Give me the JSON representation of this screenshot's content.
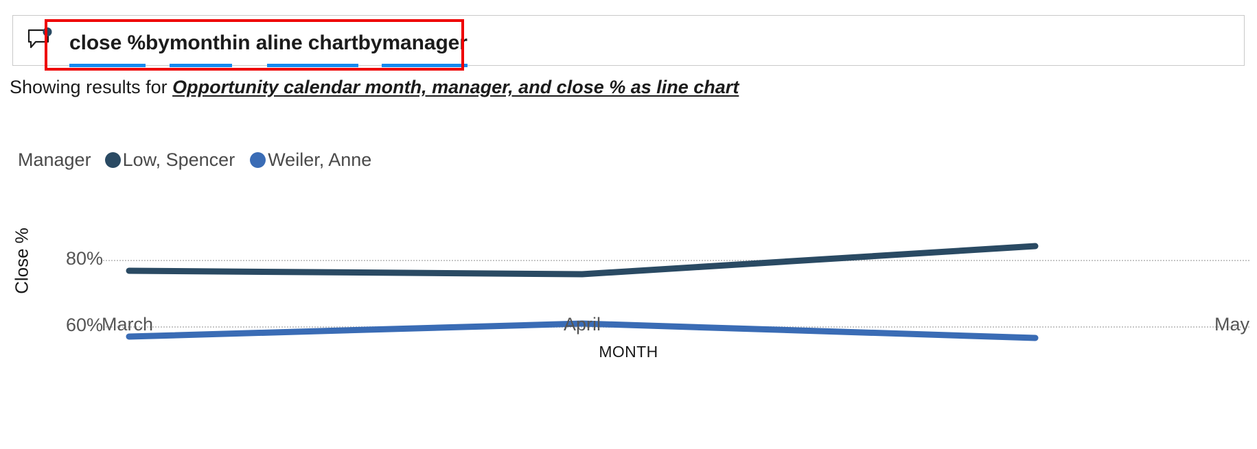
{
  "query_bar": {
    "icon": "chat-bubble-icon",
    "tokens": [
      {
        "text": "close %",
        "highlighted": true
      },
      {
        "text": " by ",
        "highlighted": false
      },
      {
        "text": "month",
        "highlighted": true
      },
      {
        "text": " in a ",
        "highlighted": false
      },
      {
        "text": "line chart",
        "highlighted": true
      },
      {
        "text": " by ",
        "highlighted": false
      },
      {
        "text": "manager",
        "highlighted": true
      }
    ],
    "full_text": "close % by month in a line chart by manager",
    "underline_color": "#1589ee",
    "annotation_color": "#ee0000"
  },
  "showing_results": {
    "prefix": "Showing results for ",
    "link": "Opportunity calendar month, manager, and close % as line chart"
  },
  "chart_data": {
    "type": "line",
    "title": "",
    "xlabel": "MONTH",
    "ylabel": "Close %",
    "categories": [
      "March",
      "April",
      "May"
    ],
    "x_tick_labels": [
      "March",
      "April",
      "May"
    ],
    "y_tick_labels": [
      "80%",
      "60%"
    ],
    "y_ticks": [
      80,
      60
    ],
    "ylim": [
      52,
      88
    ],
    "grid": true,
    "grid_style": "dotted",
    "legend_title": "Manager",
    "legend_position": "top-left",
    "series": [
      {
        "name": "Low, Spencer",
        "color": "#2a4a63",
        "values": [
          76.5,
          76.0,
          82.0
        ]
      },
      {
        "name": "Weiler, Anne",
        "color": "#3a6cb5",
        "values": [
          57.5,
          60.8,
          57.3
        ]
      }
    ]
  }
}
